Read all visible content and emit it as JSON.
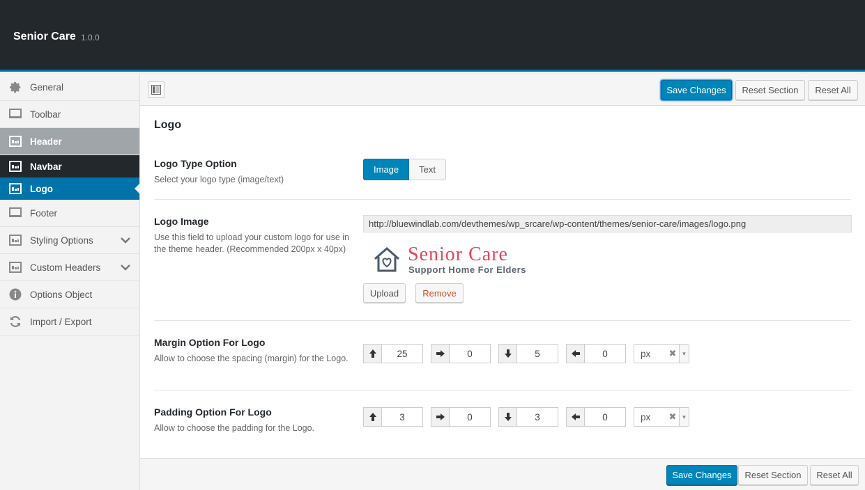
{
  "app": {
    "title": "Senior Care",
    "version": "1.0.0"
  },
  "sidebar": {
    "items": [
      {
        "label": "General",
        "icon": "gear-icon"
      },
      {
        "label": "Toolbar",
        "icon": "monitor-icon"
      },
      {
        "label": "Header",
        "icon": "layout-icon"
      },
      {
        "label": "Navbar",
        "icon": "layout-icon"
      },
      {
        "label": "Logo",
        "icon": "layout-icon"
      },
      {
        "label": "Footer",
        "icon": "monitor-icon"
      },
      {
        "label": "Styling Options",
        "icon": "layout-icon"
      },
      {
        "label": "Custom Headers",
        "icon": "layout-icon"
      },
      {
        "label": "Options Object",
        "icon": "info-icon"
      },
      {
        "label": "Import / Export",
        "icon": "refresh-icon"
      }
    ]
  },
  "toolbar": {
    "save_label": "Save Changes",
    "reset_section_label": "Reset Section",
    "reset_all_label": "Reset All"
  },
  "section": {
    "title": "Logo"
  },
  "fields": {
    "logo_type": {
      "label": "Logo Type Option",
      "desc": "Select your logo type (image/text)",
      "options": [
        "Image",
        "Text"
      ],
      "selected": "Image"
    },
    "logo_image": {
      "label": "Logo Image",
      "desc": "Use this field to upload your custom logo for use in the theme header. (Recommended 200px x 40px)",
      "url": "http://bluewindlab.com/devthemes/wp_srcare/wp-content/themes/senior-care/images/logo.png",
      "preview_brand": "Senior Care",
      "preview_tagline": "Support Home For Elders",
      "upload_label": "Upload",
      "remove_label": "Remove"
    },
    "margin": {
      "label": "Margin Option For Logo",
      "desc": "Allow to choose the spacing (margin) for the Logo.",
      "top": "25",
      "right": "0",
      "bottom": "5",
      "left": "0",
      "unit": "px"
    },
    "padding": {
      "label": "Padding Option For Logo",
      "desc": "Allow to choose the padding for the Logo.",
      "top": "3",
      "right": "0",
      "bottom": "3",
      "left": "0",
      "unit": "px"
    }
  },
  "colors": {
    "accent": "#0085ba",
    "dark": "#23282d",
    "brand": "#e2465a"
  }
}
